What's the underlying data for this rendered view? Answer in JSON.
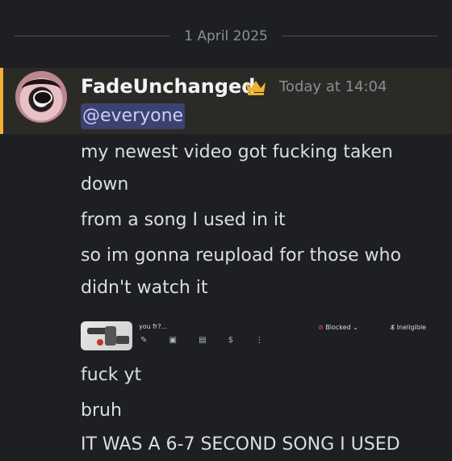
{
  "divider": {
    "date": "1 April 2025"
  },
  "message": {
    "author": "FadeUnchanged",
    "timestamp": "Today at 14:04",
    "mention": "@everyone",
    "lines": [
      "my newest video got fucking taken",
      "down",
      "from a song I used in it",
      "so im gonna reupload for those who",
      "didn't watch it"
    ],
    "after_lines": [
      "fuck yt",
      "bruh",
      "IT WAS A 6-7 SECOND SONG I USED"
    ]
  },
  "embed": {
    "title": "you fr?...",
    "tool_icons": [
      "pencil-icon",
      "analytics-icon",
      "comments-icon",
      "dollar-icon",
      "more-icon"
    ],
    "tool_glyphs": "✎ ▣ ▤ $ ⋮",
    "status": "Blocked",
    "status_icon": "⊘",
    "monetization": "Ineligible",
    "monetization_icon": "$̸"
  },
  "colors": {
    "background": "#1e1f22",
    "highlight": "#2b2a26",
    "highlight_bar": "#f0b232",
    "mention_bg": "#3c4270",
    "mention_text": "#c9cdfb",
    "crown": "#f0b232"
  }
}
